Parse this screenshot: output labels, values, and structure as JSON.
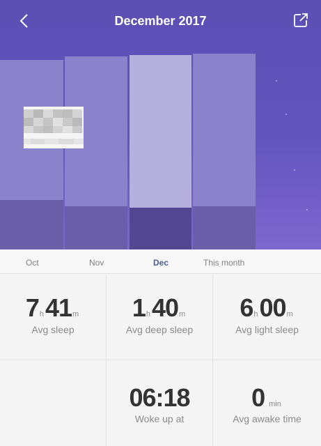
{
  "header": {
    "title": "December 2017",
    "back_icon": "chevron-left-icon",
    "share_icon": "share-external-icon"
  },
  "chart_data": {
    "type": "bar",
    "categories": [
      "Oct",
      "Nov",
      "Dec",
      "This month"
    ],
    "active_index": 2,
    "colors": {
      "light_normal": "#8b82cc",
      "deep_normal": "#6a5ea9",
      "light_active": "#b5b0de",
      "deep_active": "#524790"
    }
  },
  "tabs": [
    {
      "label": "Oct",
      "active": false
    },
    {
      "label": "Nov",
      "active": false
    },
    {
      "label": "Dec",
      "active": true
    },
    {
      "label": "This month",
      "active": false
    }
  ],
  "stats": {
    "avg_sleep": {
      "hours": "7",
      "h_unit": "h",
      "minutes": "41",
      "m_unit": "m",
      "label": "Avg sleep"
    },
    "avg_deep_sleep": {
      "hours": "1",
      "h_unit": "h",
      "minutes": "40",
      "m_unit": "m",
      "label": "Avg deep sleep"
    },
    "avg_light_sleep": {
      "hours": "6",
      "h_unit": "h",
      "minutes": "00",
      "m_unit": "m",
      "label": "Avg light sleep"
    },
    "woke_up": {
      "value": "06:18",
      "label": "Woke up at"
    },
    "avg_awake": {
      "value": "0",
      "unit": "min",
      "label": "Avg awake time"
    }
  }
}
